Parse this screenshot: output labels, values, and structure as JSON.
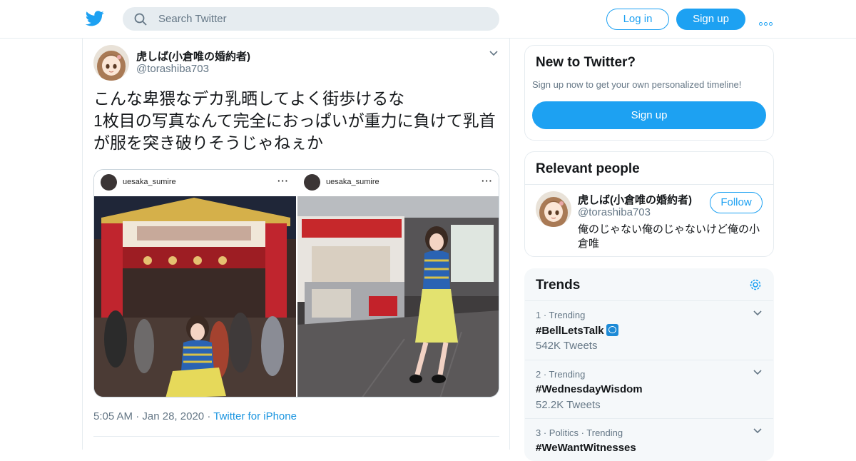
{
  "header": {
    "search_placeholder": "Search Twitter",
    "login_label": "Log in",
    "signup_label": "Sign up"
  },
  "tweet": {
    "author_name": "虎しば(小倉唯の婚約者)",
    "author_handle": "@torashiba703",
    "text": "こんな卑猥なデカ乳晒してよく街歩けるな\n1枚目の写真なんて完全におっぱいが重力に負けて乳首が服を突き破りそうじゃねぇか",
    "photos": [
      {
        "username": "uesaka_sumire",
        "menu": "···"
      },
      {
        "username": "uesaka_sumire",
        "menu": "···"
      }
    ],
    "time": "5:05 AM",
    "date": "Jan 28, 2020",
    "source": "Twitter for iPhone"
  },
  "new_to_twitter": {
    "title": "New to Twitter?",
    "subtitle": "Sign up now to get your own personalized timeline!",
    "signup_label": "Sign up"
  },
  "relevant_people": {
    "title": "Relevant people",
    "person": {
      "name": "虎しば(小倉唯の婚約者)",
      "handle": "@torashiba703",
      "follow_label": "Follow",
      "bio": "俺のじゃない俺のじゃないけど俺の小倉唯"
    }
  },
  "trends": {
    "title": "Trends",
    "items": [
      {
        "context": "1 · Trending",
        "tag": "#BellLetsTalk",
        "count": "542K Tweets"
      },
      {
        "context": "2 · Trending",
        "tag": "#WednesdayWisdom",
        "count": "52.2K Tweets"
      },
      {
        "context": "3 · Politics · Trending",
        "tag": "#WeWantWitnesses",
        "count": ""
      }
    ]
  },
  "colors": {
    "accent": "#1da1f2",
    "secondary_text": "#657786",
    "border": "#e6ecf0"
  },
  "icons": [
    "twitter-bird-icon",
    "search-icon",
    "more-icon",
    "chevron-down-icon",
    "gear-icon"
  ]
}
